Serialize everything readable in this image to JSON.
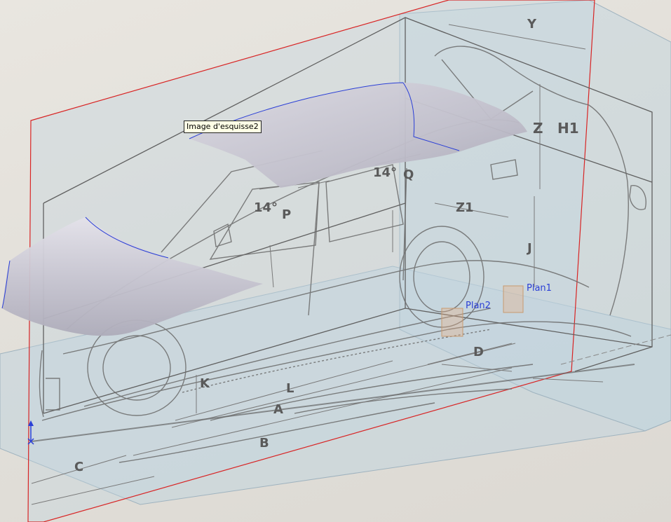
{
  "tooltip": {
    "text": "Image d'esquisse2"
  },
  "planes": {
    "plan1": "Plan1",
    "plan2": "Plan2"
  },
  "dimensions": {
    "y": "Y",
    "z": "Z",
    "h1": "H1",
    "z1": "Z1",
    "j": "J",
    "angle_front": "14°",
    "angle_rear": "14°",
    "p": "P",
    "q": "Q",
    "k": "K",
    "l": "L",
    "a": "A",
    "b": "B",
    "c": "C",
    "d": "D"
  },
  "colors": {
    "sketch_plane_border": "#d82424",
    "plane_fill": "#bcd3df",
    "surface_fill": "#c8c6d2",
    "surface_edge": "#2b3fd6",
    "plane_label": "#2b3fd6",
    "sketch_lines": "#6b6b6b"
  },
  "icons": {
    "origin": "coordinate-origin-icon"
  }
}
